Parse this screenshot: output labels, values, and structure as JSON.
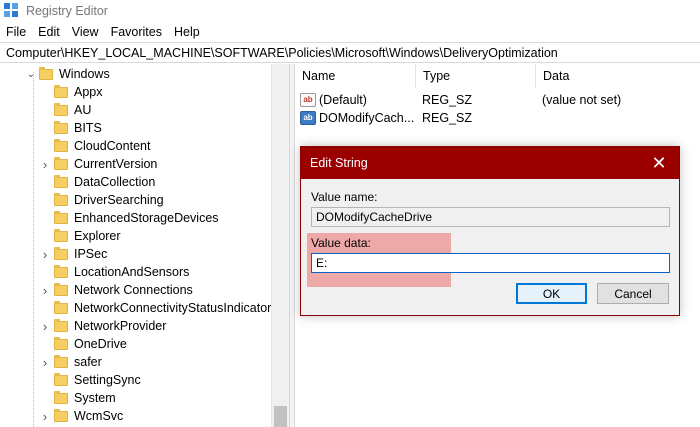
{
  "window": {
    "title": "Registry Editor"
  },
  "menu": [
    "File",
    "Edit",
    "View",
    "Favorites",
    "Help"
  ],
  "address": "Computer\\HKEY_LOCAL_MACHINE\\SOFTWARE\\Policies\\Microsoft\\Windows\\DeliveryOptimization",
  "tree": {
    "parent": "Windows",
    "items": [
      {
        "label": "Appx",
        "expandable": false
      },
      {
        "label": "AU",
        "expandable": false
      },
      {
        "label": "BITS",
        "expandable": false
      },
      {
        "label": "CloudContent",
        "expandable": false
      },
      {
        "label": "CurrentVersion",
        "expandable": true
      },
      {
        "label": "DataCollection",
        "expandable": false
      },
      {
        "label": "DriverSearching",
        "expandable": false
      },
      {
        "label": "EnhancedStorageDevices",
        "expandable": false
      },
      {
        "label": "Explorer",
        "expandable": false
      },
      {
        "label": "IPSec",
        "expandable": true
      },
      {
        "label": "LocationAndSensors",
        "expandable": false
      },
      {
        "label": "Network Connections",
        "expandable": true
      },
      {
        "label": "NetworkConnectivityStatusIndicator",
        "expandable": false
      },
      {
        "label": "NetworkProvider",
        "expandable": true
      },
      {
        "label": "OneDrive",
        "expandable": false
      },
      {
        "label": "safer",
        "expandable": true
      },
      {
        "label": "SettingSync",
        "expandable": false
      },
      {
        "label": "System",
        "expandable": false
      },
      {
        "label": "WcmSvc",
        "expandable": true
      }
    ]
  },
  "values": {
    "headers": [
      "Name",
      "Type",
      "Data"
    ],
    "rows": [
      {
        "name": "(Default)",
        "type": "REG_SZ",
        "data": "(value not set)",
        "icon": "string-value-icon"
      },
      {
        "name": "DOModifyCach...",
        "type": "REG_SZ",
        "data": "",
        "icon": "string-value-icon"
      }
    ]
  },
  "dialog": {
    "title": "Edit String",
    "value_name_label": "Value name:",
    "value_name": "DOModifyCacheDrive",
    "value_data_label": "Value data:",
    "value_data": "E:",
    "ok_label": "OK",
    "cancel_label": "Cancel",
    "close_glyph": "✕"
  },
  "colors": {
    "dialog_titlebar": "#9b0000",
    "highlight": "#eb6e6e",
    "folder": "#f5cf62"
  }
}
